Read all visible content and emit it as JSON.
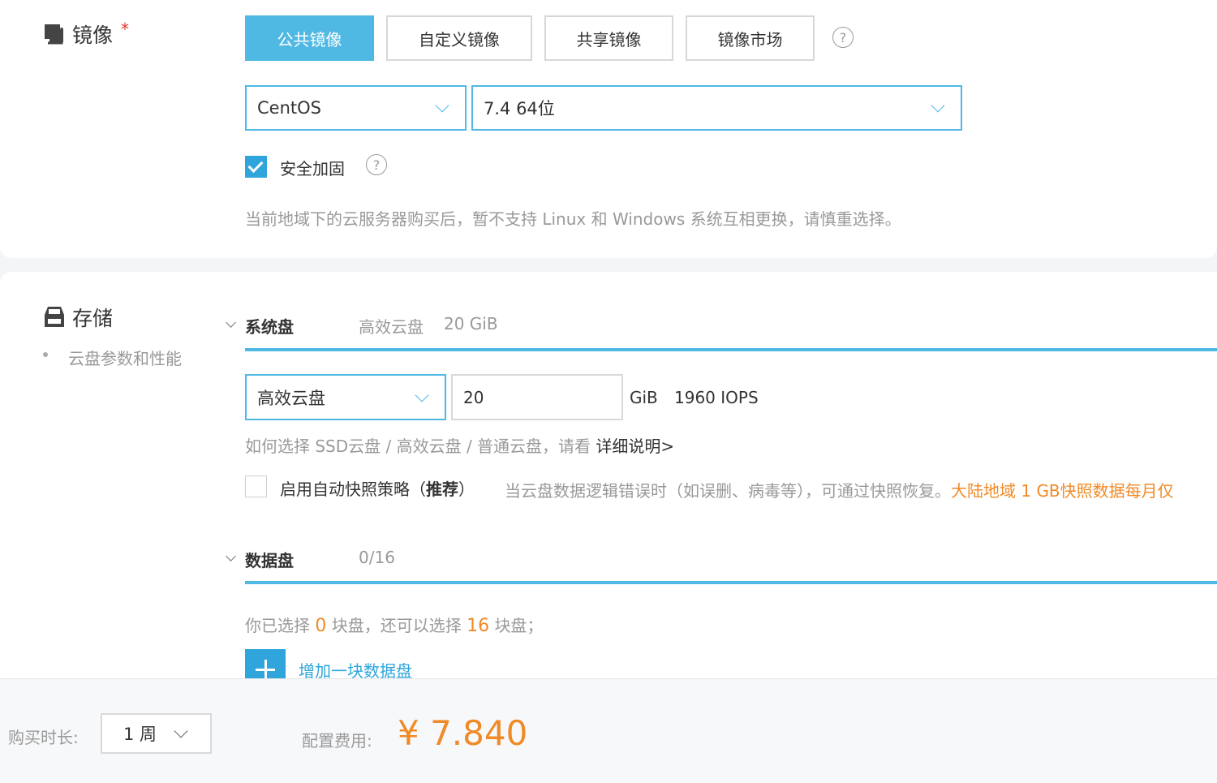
{
  "image_section": {
    "title": "镜像",
    "required_mark": "*",
    "tabs": [
      {
        "label": "公共镜像",
        "active": true
      },
      {
        "label": "自定义镜像",
        "active": false
      },
      {
        "label": "共享镜像",
        "active": false
      },
      {
        "label": "镜像市场",
        "active": false
      }
    ],
    "os_select": {
      "value": "CentOS"
    },
    "version_select": {
      "value": "7.4 64位"
    },
    "security_hardening": {
      "label": "安全加固",
      "checked": true
    },
    "notice": "当前地域下的云服务器购买后，暂不支持 Linux 和 Windows 系统互相更换，请慎重选择。"
  },
  "storage_section": {
    "title": "存储",
    "side_link": "云盘参数和性能",
    "system_disk": {
      "title": "系统盘",
      "summary_type": "高效云盘",
      "summary_size": "20 GiB",
      "type_select": "高效云盘",
      "size_value": "20",
      "unit": "GiB",
      "iops": "1960 IOPS",
      "help_text": "如何选择 SSD云盘 / 高效云盘 / 普通云盘，请看",
      "help_link": "详细说明>"
    },
    "snapshot": {
      "label": "启用自动快照策略（",
      "label_bold": "推荐",
      "label_end": "）",
      "checked": false,
      "desc": "当云盘数据逻辑错误时（如误删、病毒等），可通过快照恢复。",
      "desc_highlight": "大陆地域 1 GB快照数据每月仅"
    },
    "data_disk": {
      "title": "数据盘",
      "count": "0/16",
      "sel_prefix": "你已选择",
      "selected": "0",
      "sel_mid": "块盘，还可以选择",
      "remaining": "16",
      "sel_suffix": "块盘；",
      "add_label": "增加一块数据盘"
    }
  },
  "footer": {
    "duration_label": "购买时长:",
    "duration_value": "1 周",
    "fee_label": "配置费用:",
    "fee_value": "¥ 7.840"
  },
  "colors": {
    "accent": "#4fb9e3",
    "checkbox": "#2fa5db",
    "price": "#f08a26"
  },
  "icons": [
    "image-stack-icon",
    "help-circle-icon",
    "chevron-down-icon",
    "checkmark-icon",
    "storage-drive-icon",
    "plus-icon"
  ]
}
